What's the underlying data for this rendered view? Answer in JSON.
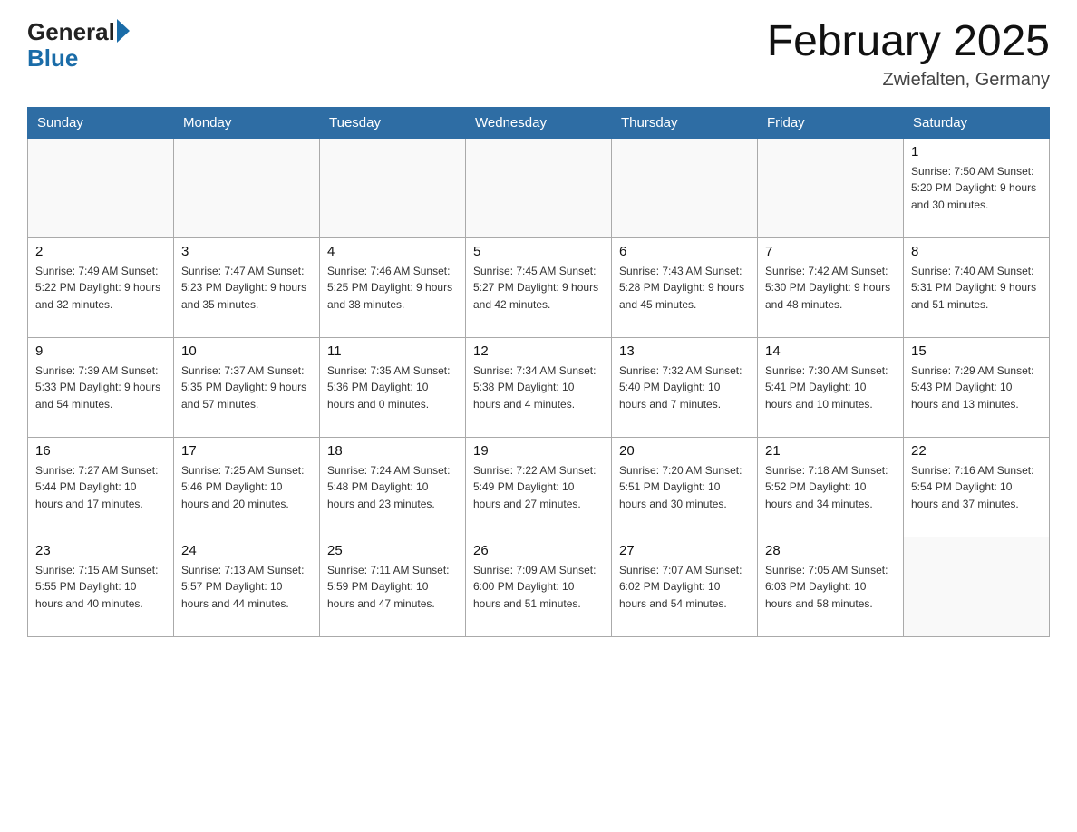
{
  "header": {
    "logo_general": "General",
    "logo_blue": "Blue",
    "month_title": "February 2025",
    "location": "Zwiefalten, Germany"
  },
  "days_of_week": [
    "Sunday",
    "Monday",
    "Tuesday",
    "Wednesday",
    "Thursday",
    "Friday",
    "Saturday"
  ],
  "weeks": [
    [
      {
        "day": "",
        "info": ""
      },
      {
        "day": "",
        "info": ""
      },
      {
        "day": "",
        "info": ""
      },
      {
        "day": "",
        "info": ""
      },
      {
        "day": "",
        "info": ""
      },
      {
        "day": "",
        "info": ""
      },
      {
        "day": "1",
        "info": "Sunrise: 7:50 AM\nSunset: 5:20 PM\nDaylight: 9 hours and 30 minutes."
      }
    ],
    [
      {
        "day": "2",
        "info": "Sunrise: 7:49 AM\nSunset: 5:22 PM\nDaylight: 9 hours and 32 minutes."
      },
      {
        "day": "3",
        "info": "Sunrise: 7:47 AM\nSunset: 5:23 PM\nDaylight: 9 hours and 35 minutes."
      },
      {
        "day": "4",
        "info": "Sunrise: 7:46 AM\nSunset: 5:25 PM\nDaylight: 9 hours and 38 minutes."
      },
      {
        "day": "5",
        "info": "Sunrise: 7:45 AM\nSunset: 5:27 PM\nDaylight: 9 hours and 42 minutes."
      },
      {
        "day": "6",
        "info": "Sunrise: 7:43 AM\nSunset: 5:28 PM\nDaylight: 9 hours and 45 minutes."
      },
      {
        "day": "7",
        "info": "Sunrise: 7:42 AM\nSunset: 5:30 PM\nDaylight: 9 hours and 48 minutes."
      },
      {
        "day": "8",
        "info": "Sunrise: 7:40 AM\nSunset: 5:31 PM\nDaylight: 9 hours and 51 minutes."
      }
    ],
    [
      {
        "day": "9",
        "info": "Sunrise: 7:39 AM\nSunset: 5:33 PM\nDaylight: 9 hours and 54 minutes."
      },
      {
        "day": "10",
        "info": "Sunrise: 7:37 AM\nSunset: 5:35 PM\nDaylight: 9 hours and 57 minutes."
      },
      {
        "day": "11",
        "info": "Sunrise: 7:35 AM\nSunset: 5:36 PM\nDaylight: 10 hours and 0 minutes."
      },
      {
        "day": "12",
        "info": "Sunrise: 7:34 AM\nSunset: 5:38 PM\nDaylight: 10 hours and 4 minutes."
      },
      {
        "day": "13",
        "info": "Sunrise: 7:32 AM\nSunset: 5:40 PM\nDaylight: 10 hours and 7 minutes."
      },
      {
        "day": "14",
        "info": "Sunrise: 7:30 AM\nSunset: 5:41 PM\nDaylight: 10 hours and 10 minutes."
      },
      {
        "day": "15",
        "info": "Sunrise: 7:29 AM\nSunset: 5:43 PM\nDaylight: 10 hours and 13 minutes."
      }
    ],
    [
      {
        "day": "16",
        "info": "Sunrise: 7:27 AM\nSunset: 5:44 PM\nDaylight: 10 hours and 17 minutes."
      },
      {
        "day": "17",
        "info": "Sunrise: 7:25 AM\nSunset: 5:46 PM\nDaylight: 10 hours and 20 minutes."
      },
      {
        "day": "18",
        "info": "Sunrise: 7:24 AM\nSunset: 5:48 PM\nDaylight: 10 hours and 23 minutes."
      },
      {
        "day": "19",
        "info": "Sunrise: 7:22 AM\nSunset: 5:49 PM\nDaylight: 10 hours and 27 minutes."
      },
      {
        "day": "20",
        "info": "Sunrise: 7:20 AM\nSunset: 5:51 PM\nDaylight: 10 hours and 30 minutes."
      },
      {
        "day": "21",
        "info": "Sunrise: 7:18 AM\nSunset: 5:52 PM\nDaylight: 10 hours and 34 minutes."
      },
      {
        "day": "22",
        "info": "Sunrise: 7:16 AM\nSunset: 5:54 PM\nDaylight: 10 hours and 37 minutes."
      }
    ],
    [
      {
        "day": "23",
        "info": "Sunrise: 7:15 AM\nSunset: 5:55 PM\nDaylight: 10 hours and 40 minutes."
      },
      {
        "day": "24",
        "info": "Sunrise: 7:13 AM\nSunset: 5:57 PM\nDaylight: 10 hours and 44 minutes."
      },
      {
        "day": "25",
        "info": "Sunrise: 7:11 AM\nSunset: 5:59 PM\nDaylight: 10 hours and 47 minutes."
      },
      {
        "day": "26",
        "info": "Sunrise: 7:09 AM\nSunset: 6:00 PM\nDaylight: 10 hours and 51 minutes."
      },
      {
        "day": "27",
        "info": "Sunrise: 7:07 AM\nSunset: 6:02 PM\nDaylight: 10 hours and 54 minutes."
      },
      {
        "day": "28",
        "info": "Sunrise: 7:05 AM\nSunset: 6:03 PM\nDaylight: 10 hours and 58 minutes."
      },
      {
        "day": "",
        "info": ""
      }
    ]
  ]
}
